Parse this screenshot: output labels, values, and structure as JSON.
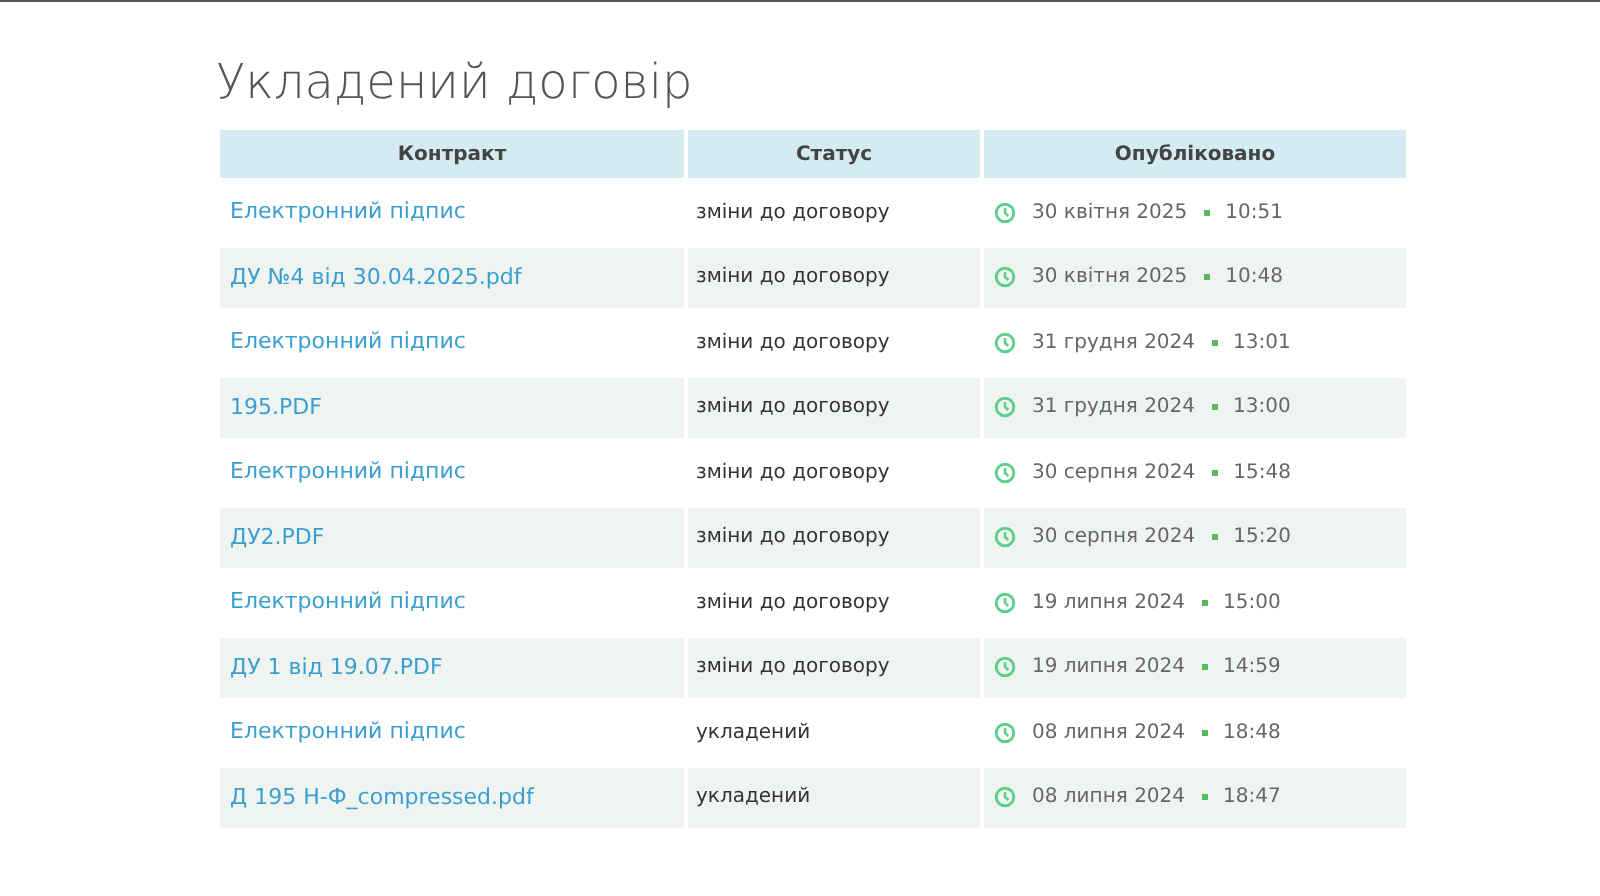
{
  "title": "Укладений договір",
  "table": {
    "columns": [
      "Контракт",
      "Статус",
      "Опубліковано"
    ],
    "rows": [
      {
        "contract": "Електронний підпис",
        "status": "зміни до договору",
        "date": "30 квітня 2025",
        "time": "10:51"
      },
      {
        "contract": "ДУ №4 від 30.04.2025.pdf",
        "status": "зміни до договору",
        "date": "30 квітня 2025",
        "time": "10:48"
      },
      {
        "contract": "Електронний підпис",
        "status": "зміни до договору",
        "date": "31 грудня 2024",
        "time": "13:01"
      },
      {
        "contract": "195.PDF",
        "status": "зміни до договору",
        "date": "31 грудня 2024",
        "time": "13:00"
      },
      {
        "contract": "Електронний підпис",
        "status": "зміни до договору",
        "date": "30 серпня 2024",
        "time": "15:48"
      },
      {
        "contract": "ДУ2.PDF",
        "status": "зміни до договору",
        "date": "30 серпня 2024",
        "time": "15:20"
      },
      {
        "contract": "Електронний підпис",
        "status": "зміни до договору",
        "date": "19 липня 2024",
        "time": "15:00"
      },
      {
        "contract": "ДУ 1 від 19.07.PDF",
        "status": "зміни до договору",
        "date": "19 липня 2024",
        "time": "14:59"
      },
      {
        "contract": "Електронний підпис",
        "status": "укладений",
        "date": "08 липня 2024",
        "time": "18:48"
      },
      {
        "contract": "Д 195 Н-Ф_compressed.pdf",
        "status": "укладений",
        "date": "08 липня 2024",
        "time": "18:47"
      }
    ]
  }
}
